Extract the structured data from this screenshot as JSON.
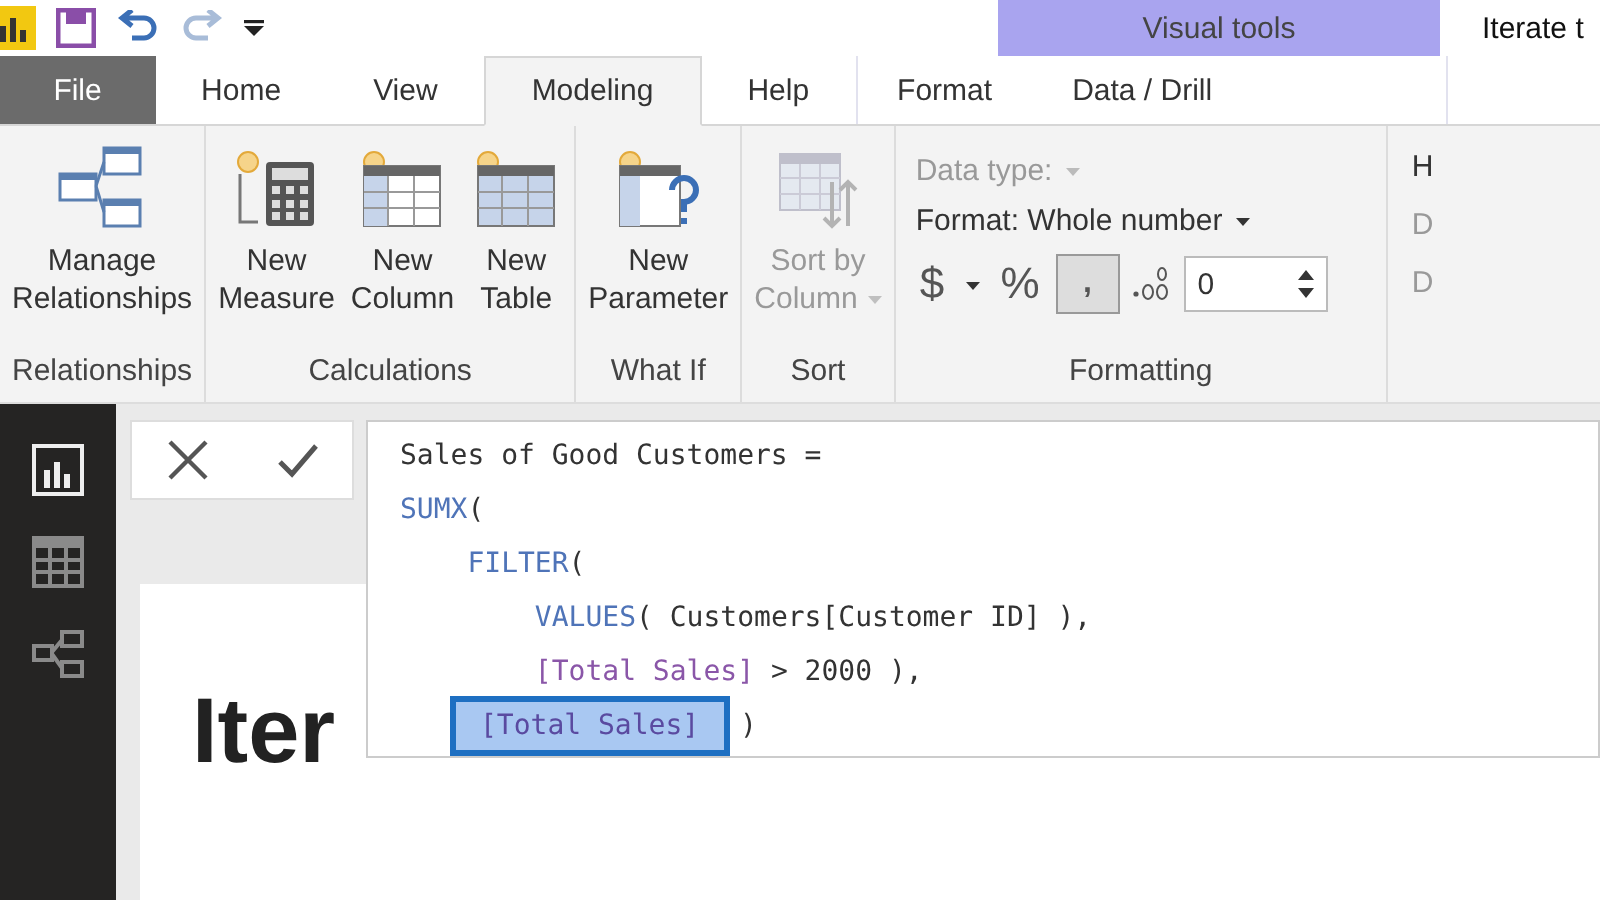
{
  "document_title": "Iterate t",
  "contextual": {
    "title": "Visual tools",
    "tabs": [
      {
        "label": "Format",
        "selected": false
      },
      {
        "label": "Data / Drill",
        "selected": false
      }
    ]
  },
  "tabs": [
    {
      "label": "File",
      "kind": "file",
      "selected": false
    },
    {
      "label": "Home",
      "kind": "tab",
      "selected": false
    },
    {
      "label": "View",
      "kind": "tab",
      "selected": false
    },
    {
      "label": "Modeling",
      "kind": "tab",
      "selected": true
    },
    {
      "label": "Help",
      "kind": "tab",
      "selected": false
    }
  ],
  "ribbon": {
    "groups": [
      {
        "kind": "buttons",
        "label": "Relationships",
        "buttons": [
          {
            "lines": [
              "Manage",
              "Relationships"
            ],
            "disabled": false,
            "dropdown": false
          }
        ]
      },
      {
        "kind": "buttons",
        "label": "Calculations",
        "buttons": [
          {
            "lines": [
              "New",
              "Measure"
            ],
            "disabled": false,
            "dropdown": false
          },
          {
            "lines": [
              "New",
              "Column"
            ],
            "disabled": false,
            "dropdown": false
          },
          {
            "lines": [
              "New",
              "Table"
            ],
            "disabled": false,
            "dropdown": false
          }
        ]
      },
      {
        "kind": "buttons",
        "label": "What If",
        "buttons": [
          {
            "lines": [
              "New",
              "Parameter"
            ],
            "disabled": false,
            "dropdown": false
          }
        ]
      },
      {
        "kind": "buttons",
        "label": "Sort",
        "buttons": [
          {
            "lines": [
              "Sort by",
              "Column"
            ],
            "disabled": true,
            "dropdown": true
          }
        ]
      },
      {
        "kind": "formatting",
        "label": "Formatting",
        "data_type": {
          "label": "Data type:",
          "disabled": true
        },
        "format": {
          "label": "Format: Whole number"
        },
        "currency": "$",
        "percent": "%",
        "comma": {
          "label": ",",
          "selected": true
        },
        "decimals": {
          "value": "0"
        }
      },
      {
        "kind": "partial",
        "lines": [
          "H",
          "D",
          "D"
        ]
      }
    ]
  },
  "rail": [
    {
      "selected": true
    },
    {
      "selected": false
    },
    {
      "selected": false
    }
  ],
  "formula_bar": {
    "lines": [
      [
        {
          "kind": "plain",
          "text": "Sales of Good Customers ="
        }
      ],
      [
        {
          "kind": "function",
          "text": "SUMX"
        },
        {
          "kind": "plain",
          "text": "("
        }
      ],
      [
        {
          "kind": "function",
          "text": "    FILTER"
        },
        {
          "kind": "plain",
          "text": "("
        }
      ],
      [
        {
          "kind": "function",
          "text": "        VALUES"
        },
        {
          "kind": "plain",
          "text": "( Customers[Customer ID] ),"
        }
      ],
      [
        {
          "kind": "measure",
          "text": "        [Total Sales]"
        },
        {
          "kind": "plain",
          "text": " > 2000 ),"
        }
      ],
      [
        {
          "kind": "selection",
          "text": "[Total Sales]"
        },
        {
          "kind": "plain",
          "text": " )"
        }
      ]
    ]
  },
  "canvas": {
    "heading": "Iter"
  }
}
